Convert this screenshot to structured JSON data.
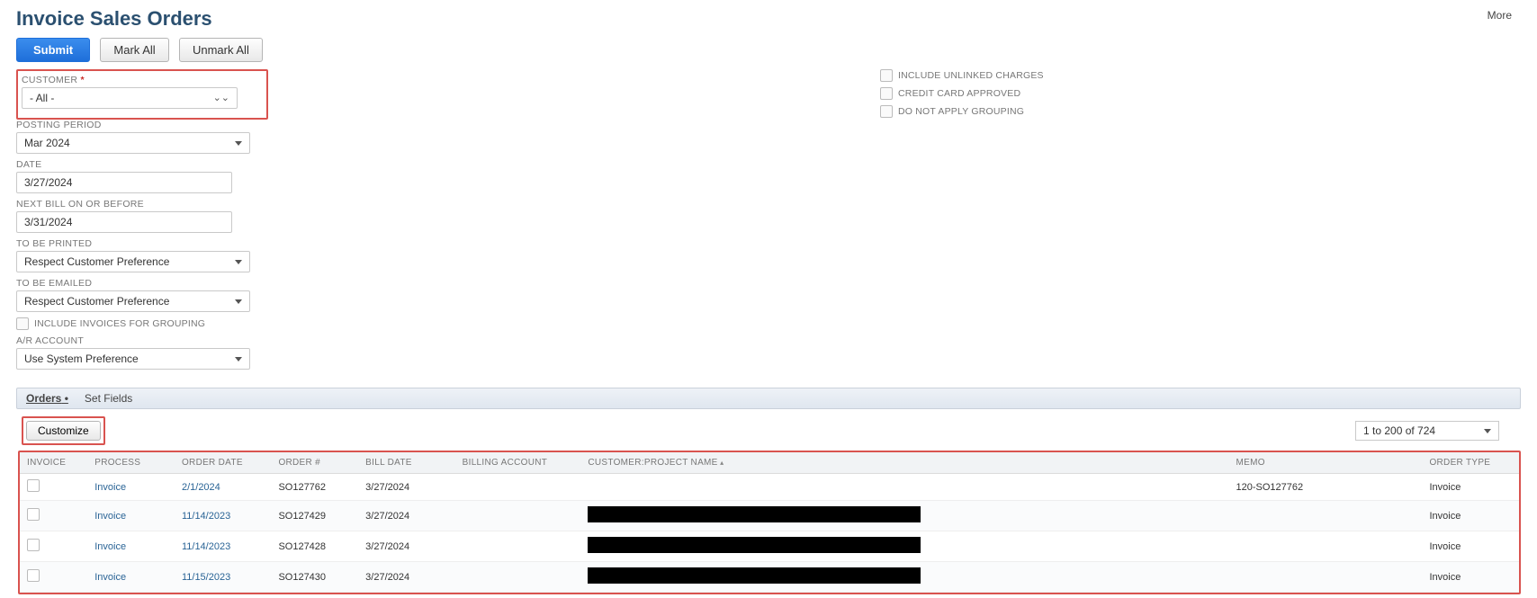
{
  "page": {
    "title": "Invoice Sales Orders",
    "more": "More"
  },
  "buttons": {
    "submit": "Submit",
    "mark_all": "Mark All",
    "unmark_all": "Unmark All",
    "customize": "Customize"
  },
  "filters": {
    "customer": {
      "label": "CUSTOMER",
      "value": "- All -"
    },
    "posting_period": {
      "label": "POSTING PERIOD",
      "value": "Mar 2024"
    },
    "date": {
      "label": "DATE",
      "value": "3/27/2024"
    },
    "next_bill": {
      "label": "NEXT BILL ON OR BEFORE",
      "value": "3/31/2024"
    },
    "to_be_printed": {
      "label": "TO BE PRINTED",
      "value": "Respect Customer Preference"
    },
    "to_be_emailed": {
      "label": "TO BE EMAILED",
      "value": "Respect Customer Preference"
    },
    "include_invoices": "INCLUDE INVOICES FOR GROUPING",
    "ar_account": {
      "label": "A/R ACCOUNT",
      "value": "Use System Preference"
    }
  },
  "right_checks": {
    "include_unlinked": "INCLUDE UNLINKED CHARGES",
    "credit_card_approved": "CREDIT CARD APPROVED",
    "do_not_apply_grouping": "DO NOT APPLY GROUPING"
  },
  "tabs": {
    "orders": "Orders",
    "set_fields": "Set Fields"
  },
  "pager": {
    "text": "1 to 200 of 724"
  },
  "columns": {
    "invoice": "INVOICE",
    "process": "PROCESS",
    "order_date": "ORDER DATE",
    "order_num": "ORDER #",
    "bill_date": "BILL DATE",
    "billing_account": "BILLING ACCOUNT",
    "customer": "CUSTOMER:PROJECT NAME",
    "memo": "MEMO",
    "order_type": "ORDER TYPE"
  },
  "rows": [
    {
      "process": "Invoice",
      "order_date": "2/1/2024",
      "order_num": "SO127762",
      "bill_date": "3/27/2024",
      "memo": "120-SO127762",
      "order_type": "Invoice"
    },
    {
      "process": "Invoice",
      "order_date": "11/14/2023",
      "order_num": "SO127429",
      "bill_date": "3/27/2024",
      "memo": "",
      "order_type": "Invoice"
    },
    {
      "process": "Invoice",
      "order_date": "11/14/2023",
      "order_num": "SO127428",
      "bill_date": "3/27/2024",
      "memo": "",
      "order_type": "Invoice"
    },
    {
      "process": "Invoice",
      "order_date": "11/15/2023",
      "order_num": "SO127430",
      "bill_date": "3/27/2024",
      "memo": "",
      "order_type": "Invoice"
    }
  ]
}
